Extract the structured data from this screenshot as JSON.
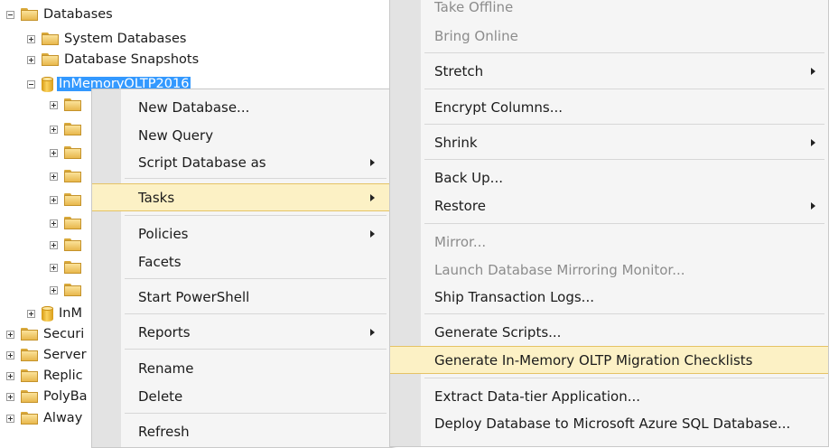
{
  "tree": {
    "databases": "Databases",
    "system_databases": "System Databases",
    "database_snapshots": "Database Snapshots",
    "selected_db": "InMemoryOLTP2016",
    "sibling_db": "InM",
    "security": "Securi",
    "server_objects": "Server",
    "replication": "Replic",
    "polybase": "PolyBa",
    "always_on": "Alway"
  },
  "context_menu": {
    "items": [
      {
        "label": "New Database..."
      },
      {
        "label": "New Query"
      },
      {
        "label": "Script Database as"
      },
      {
        "label": "Tasks"
      },
      {
        "label": "Policies"
      },
      {
        "label": "Facets"
      },
      {
        "label": "Start PowerShell"
      },
      {
        "label": "Reports"
      },
      {
        "label": "Rename"
      },
      {
        "label": "Delete"
      },
      {
        "label": "Refresh"
      }
    ]
  },
  "tasks_menu": {
    "items": [
      {
        "label": "Take Offline"
      },
      {
        "label": "Bring Online"
      },
      {
        "label": "Stretch"
      },
      {
        "label": "Encrypt Columns..."
      },
      {
        "label": "Shrink"
      },
      {
        "label": "Back Up..."
      },
      {
        "label": "Restore"
      },
      {
        "label": "Mirror..."
      },
      {
        "label": "Launch Database Mirroring Monitor..."
      },
      {
        "label": "Ship Transaction Logs..."
      },
      {
        "label": "Generate Scripts..."
      },
      {
        "label": "Generate In-Memory OLTP Migration Checklists"
      },
      {
        "label": "Extract Data-tier Application..."
      },
      {
        "label": "Deploy Database to Microsoft Azure SQL Database..."
      }
    ]
  },
  "colors": {
    "highlight": "#fcf1c5",
    "selection": "#3399ff",
    "menu_background": "#f5f5f5"
  }
}
